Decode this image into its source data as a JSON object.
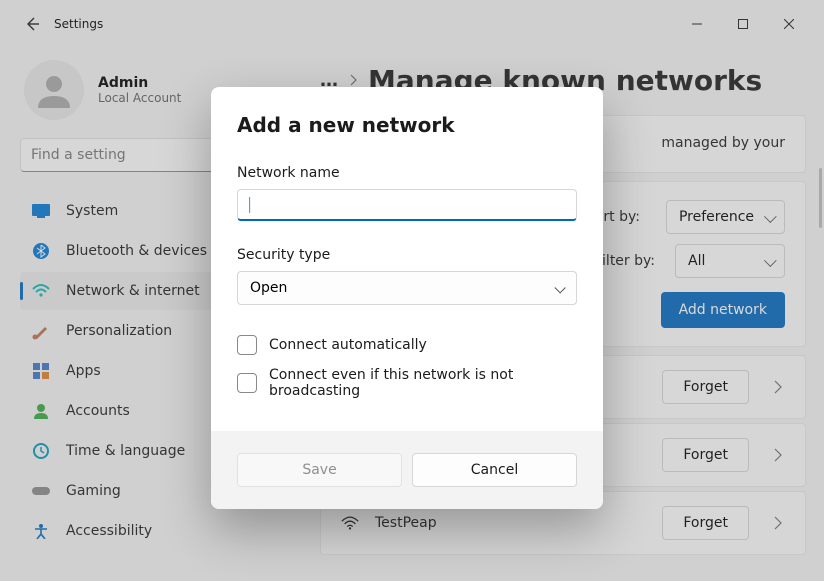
{
  "titlebar": {
    "app_title": "Settings"
  },
  "profile": {
    "name": "Admin",
    "subtitle": "Local Account"
  },
  "search": {
    "placeholder": "Find a setting"
  },
  "sidebar": {
    "items": [
      {
        "label": "System",
        "icon": "system-icon",
        "color": "#0078d4"
      },
      {
        "label": "Bluetooth & devices",
        "icon": "bluetooth-icon",
        "color": "#0078d4"
      },
      {
        "label": "Network & internet",
        "icon": "wifi-icon",
        "color": "#0abab5",
        "active": true
      },
      {
        "label": "Personalization",
        "icon": "brush-icon",
        "color": "#d08060"
      },
      {
        "label": "Apps",
        "icon": "apps-icon",
        "color": "#3b78c8"
      },
      {
        "label": "Accounts",
        "icon": "accounts-icon",
        "color": "#36a93f"
      },
      {
        "label": "Time & language",
        "icon": "time-icon",
        "color": "#0099bc"
      },
      {
        "label": "Gaming",
        "icon": "gaming-icon",
        "color": "#8a8a8a"
      },
      {
        "label": "Accessibility",
        "icon": "accessibility-icon",
        "color": "#0067c0"
      }
    ]
  },
  "main": {
    "breadcrumb_ellipsis": "…",
    "page_title": "Manage known networks",
    "info_panel": "managed by your",
    "sort": {
      "label": "Sort by:",
      "value": "Preference"
    },
    "filter": {
      "label": "Filter by:",
      "value": "All"
    },
    "add_btn": "Add network",
    "forget_btn": "Forget",
    "networks": [
      {
        "name": ""
      },
      {
        "name": ""
      },
      {
        "name": "TestPeap"
      }
    ]
  },
  "dialog": {
    "title": "Add a new network",
    "network_name_label": "Network name",
    "network_name_value": "",
    "security_type_label": "Security type",
    "security_type_value": "Open",
    "connect_auto": "Connect automatically",
    "connect_hidden": "Connect even if this network is not broadcasting",
    "save": "Save",
    "cancel": "Cancel"
  }
}
